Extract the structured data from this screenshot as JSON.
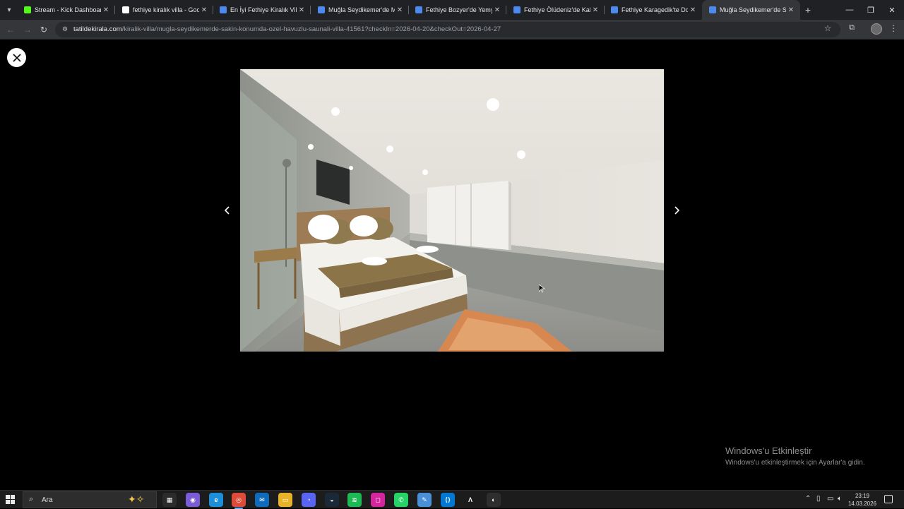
{
  "browser": {
    "tabs": [
      {
        "title": "Stream - Kick Dashboard",
        "favicon_color": "#53fc18",
        "active": false
      },
      {
        "title": "fethiye kiralık villa - Goog",
        "favicon_color": "#ffffff",
        "active": false
      },
      {
        "title": "En İyi Fethiye Kiralık Villa",
        "favicon_color": "#4d8af0",
        "active": false
      },
      {
        "title": "Muğla Seydikemer'de Mu",
        "favicon_color": "#4d8af0",
        "active": false
      },
      {
        "title": "Fethiye Bozyer'de Yemyeş",
        "favicon_color": "#4d8af0",
        "active": false
      },
      {
        "title": "Fethiye Ölüdeniz'de Kalat",
        "favicon_color": "#4d8af0",
        "active": false
      },
      {
        "title": "Fethiye Karagedik'te Doğ",
        "favicon_color": "#4d8af0",
        "active": false
      },
      {
        "title": "Muğla Seydikemer'de Sak",
        "favicon_color": "#4d8af0",
        "active": true
      }
    ],
    "url_host": "tatildekirala.com",
    "url_path": "/kiralik-villa/mugla-seydikemerde-sakin-konumda-ozel-havuzlu-saunali-villa-41561?checkIn=2026-04-20&checkOut=2026-04-27"
  },
  "gallery": {
    "close_icon": "close-icon",
    "prev_icon": "chevron-left-icon",
    "next_icon": "chevron-right-icon"
  },
  "watermark": {
    "title": "Windows'u Etkinleştir",
    "subtitle": "Windows'u etkinleştirmek için Ayarlar'a gidin."
  },
  "taskbar": {
    "search_placeholder": "Ara",
    "apps": [
      {
        "name": "task-view",
        "color": "#2b2b2b",
        "glyph": "▦"
      },
      {
        "name": "copilot",
        "color": "#7b5cd6",
        "glyph": "◉"
      },
      {
        "name": "edge",
        "color": "#1c8fd8",
        "glyph": "e"
      },
      {
        "name": "chrome",
        "color": "#dd4b39",
        "glyph": "◎",
        "active": true
      },
      {
        "name": "outlook",
        "color": "#0f6cbd",
        "glyph": "✉"
      },
      {
        "name": "file-explorer",
        "color": "#e8b12a",
        "glyph": "▭"
      },
      {
        "name": "discord",
        "color": "#5865f2",
        "glyph": "◔"
      },
      {
        "name": "steam",
        "color": "#1b2838",
        "glyph": "◒"
      },
      {
        "name": "spotify",
        "color": "#1db954",
        "glyph": "≋"
      },
      {
        "name": "instagram",
        "color": "#d6249f",
        "glyph": "◻"
      },
      {
        "name": "whatsapp",
        "color": "#25d366",
        "glyph": "✆"
      },
      {
        "name": "notepad",
        "color": "#4a90d9",
        "glyph": "✎"
      },
      {
        "name": "vscode",
        "color": "#0078d4",
        "glyph": "⟨⟩"
      },
      {
        "name": "arc-app",
        "color": "#1c1c1c",
        "glyph": "Λ"
      },
      {
        "name": "obs",
        "color": "#2e2e2e",
        "glyph": "◐"
      }
    ],
    "time": "23:19",
    "date": "14.03.2026"
  }
}
